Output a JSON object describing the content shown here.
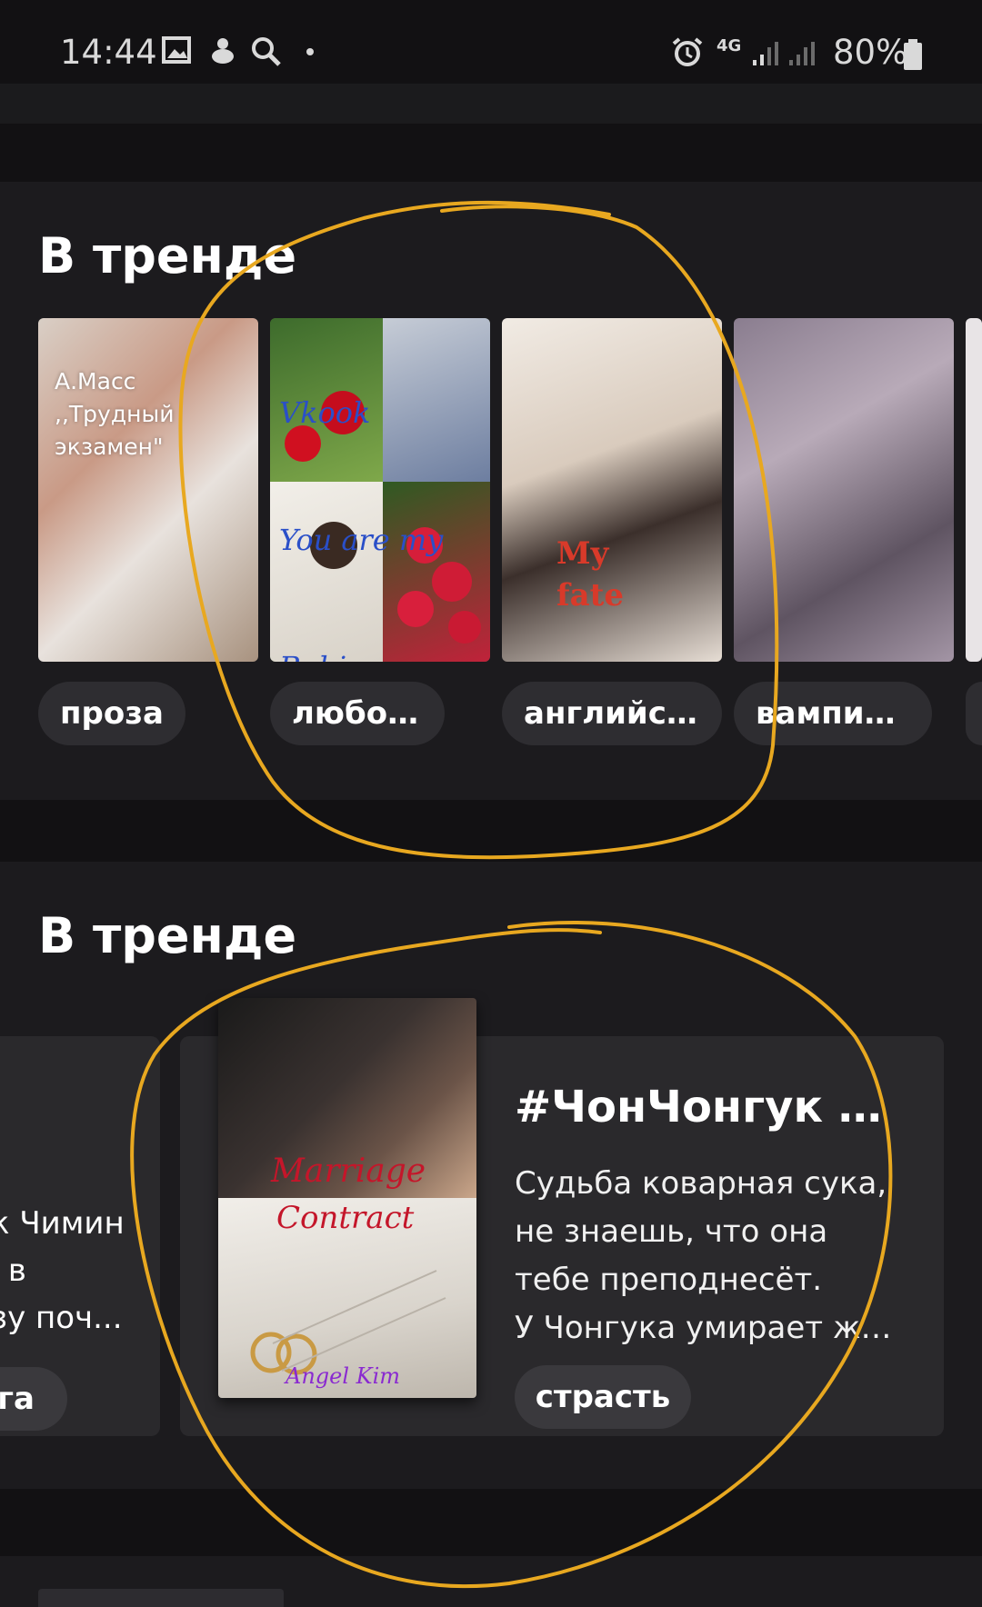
{
  "status_bar": {
    "time": "14:44",
    "network": "4G",
    "battery": "80%",
    "icons": [
      "image-icon",
      "notification-app-icon",
      "search-icon",
      "dot-icon",
      "alarm-icon",
      "network-4g-icon",
      "signal-icon",
      "signal-icon-2",
      "battery-icon"
    ]
  },
  "sections": [
    {
      "title": "В тренде",
      "books": [
        {
          "cover_text": "А.Масс\n,,Трудный\nэкзамен\"",
          "tag": "проза"
        },
        {
          "cover_text": "Vkook\nYou are my\nRobin\nAngel Kim",
          "tag": "любовь"
        },
        {
          "cover_text": "My\nfate",
          "tag": "английск..."
        },
        {
          "cover_text": "",
          "tag": "вампиры"
        }
      ]
    },
    {
      "title": "В тренде",
      "left_card": {
        "lines": [
          "к Чимин",
          "ь в",
          "зу поч..."
        ],
        "tag": "ега"
      },
      "featured": {
        "cover_text": {
          "line1": "Marriage",
          "line2": "Contract",
          "author": "Angel Kim"
        },
        "title": "#ЧонЧонгук  \"З...",
        "description": [
          "Судьба коварная сука,",
          "не знаешь, что она",
          "тебе преподнесёт.",
          "У Чонгука умирает жена..."
        ],
        "tag": "страсть"
      }
    }
  ],
  "colors": {
    "background": "#121113",
    "section_bg": "#1c1b1e",
    "chip_bg": "#2e2d31",
    "annotation": "#e8a820"
  }
}
